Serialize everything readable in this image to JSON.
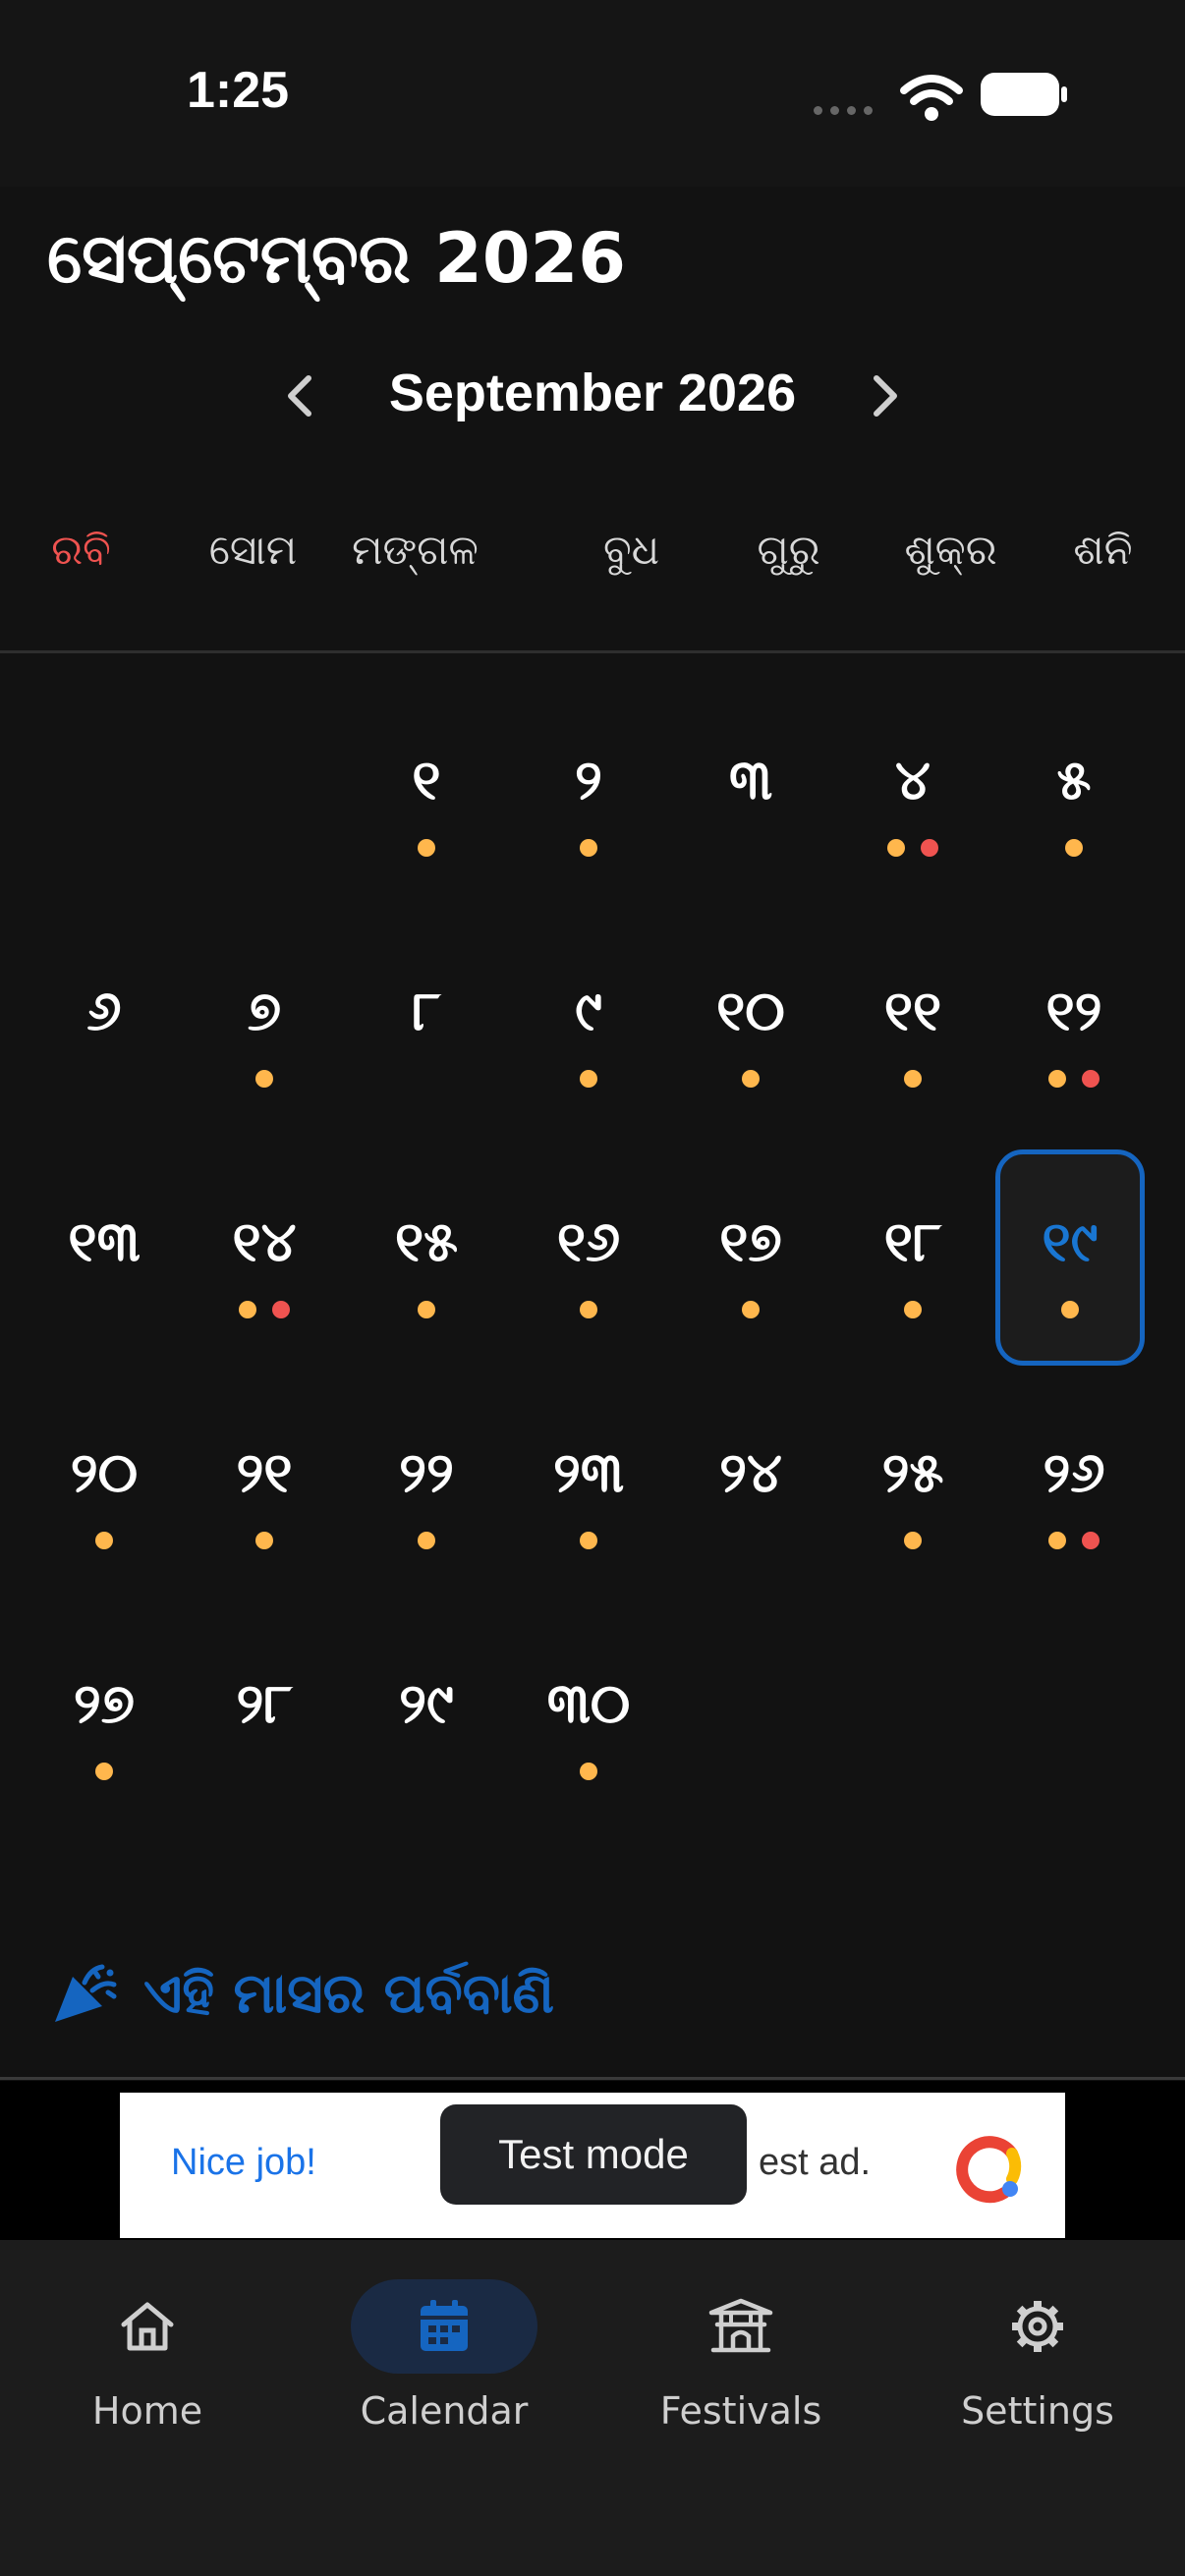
{
  "status_bar": {
    "time": "1:25"
  },
  "header": {
    "title": "ସେପ୍ଟେମ୍ବର 2026",
    "month_label": "September 2026"
  },
  "weekdays": [
    "ରବି",
    "ସୋମ",
    "ମଙ୍ଗଳ",
    "ବୁଧ",
    "ଗୁରୁ",
    "ଶୁକ୍ର",
    "ଶନି"
  ],
  "calendar": {
    "days": [
      {
        "label": "୧",
        "dots": [
          "orange"
        ]
      },
      {
        "label": "୨",
        "dots": [
          "orange"
        ]
      },
      {
        "label": "୩",
        "dots": []
      },
      {
        "label": "୪",
        "dots": [
          "orange",
          "red"
        ]
      },
      {
        "label": "୫",
        "dots": [
          "orange"
        ]
      },
      {
        "label": "୬",
        "dots": []
      },
      {
        "label": "୭",
        "dots": [
          "orange"
        ]
      },
      {
        "label": "୮",
        "dots": []
      },
      {
        "label": "୯",
        "dots": [
          "orange"
        ]
      },
      {
        "label": "୧୦",
        "dots": [
          "orange"
        ]
      },
      {
        "label": "୧୧",
        "dots": [
          "orange"
        ]
      },
      {
        "label": "୧୨",
        "dots": [
          "orange",
          "red"
        ]
      },
      {
        "label": "୧୩",
        "dots": []
      },
      {
        "label": "୧୪",
        "dots": [
          "orange",
          "red"
        ]
      },
      {
        "label": "୧୫",
        "dots": [
          "orange"
        ]
      },
      {
        "label": "୧୬",
        "dots": [
          "orange"
        ]
      },
      {
        "label": "୧୭",
        "dots": [
          "orange"
        ]
      },
      {
        "label": "୧୮",
        "dots": [
          "orange"
        ]
      },
      {
        "label": "୧୯",
        "dots": [
          "orange"
        ],
        "selected": true
      },
      {
        "label": "୨୦",
        "dots": [
          "orange"
        ]
      },
      {
        "label": "୨୧",
        "dots": [
          "orange"
        ]
      },
      {
        "label": "୨୨",
        "dots": [
          "orange"
        ]
      },
      {
        "label": "୨୩",
        "dots": [
          "orange"
        ]
      },
      {
        "label": "୨୪",
        "dots": []
      },
      {
        "label": "୨୫",
        "dots": [
          "orange"
        ]
      },
      {
        "label": "୨୬",
        "dots": [
          "orange",
          "red"
        ]
      },
      {
        "label": "୨୭",
        "dots": [
          "orange"
        ]
      },
      {
        "label": "୨୮",
        "dots": []
      },
      {
        "label": "୨୯",
        "dots": []
      },
      {
        "label": "୩୦",
        "dots": [
          "orange"
        ]
      }
    ]
  },
  "festivals": {
    "heading": "ଏହି ମାସର ପର୍ବବାଣି",
    "icon": "party-popper-icon"
  },
  "ad": {
    "left_text": "Nice job!",
    "right_text": "est ad.",
    "toast": "Test mode"
  },
  "bottom_nav": [
    {
      "label": "Home",
      "icon": "home-icon"
    },
    {
      "label": "Calendar",
      "icon": "calendar-icon",
      "active": true
    },
    {
      "label": "Festivals",
      "icon": "temple-icon"
    },
    {
      "label": "Settings",
      "icon": "gear-icon"
    }
  ],
  "colors": {
    "background": "#121212",
    "accent": "#1565c0",
    "sunday": "#ef5350",
    "dot_orange": "#ffb74d",
    "dot_red": "#ef5350"
  }
}
